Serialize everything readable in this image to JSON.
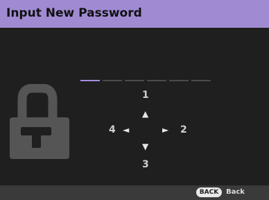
{
  "title": "Input New Password",
  "password": {
    "slot_count": 6,
    "active_slot": 0
  },
  "keypad": {
    "up": {
      "number": "1",
      "arrow": "▲"
    },
    "right": {
      "number": "2",
      "arrow": "►"
    },
    "down": {
      "number": "3",
      "arrow": "▼"
    },
    "left": {
      "number": "4",
      "arrow": "◄"
    }
  },
  "footer": {
    "back_key": "BACK",
    "back_label": "Back"
  },
  "colors": {
    "title_bar": "#a08bd2",
    "active_slot": "#a58ee3",
    "background": "#1f1f1f",
    "footer": "#3a3a3a"
  },
  "icons": {
    "lock": "lock-icon"
  }
}
